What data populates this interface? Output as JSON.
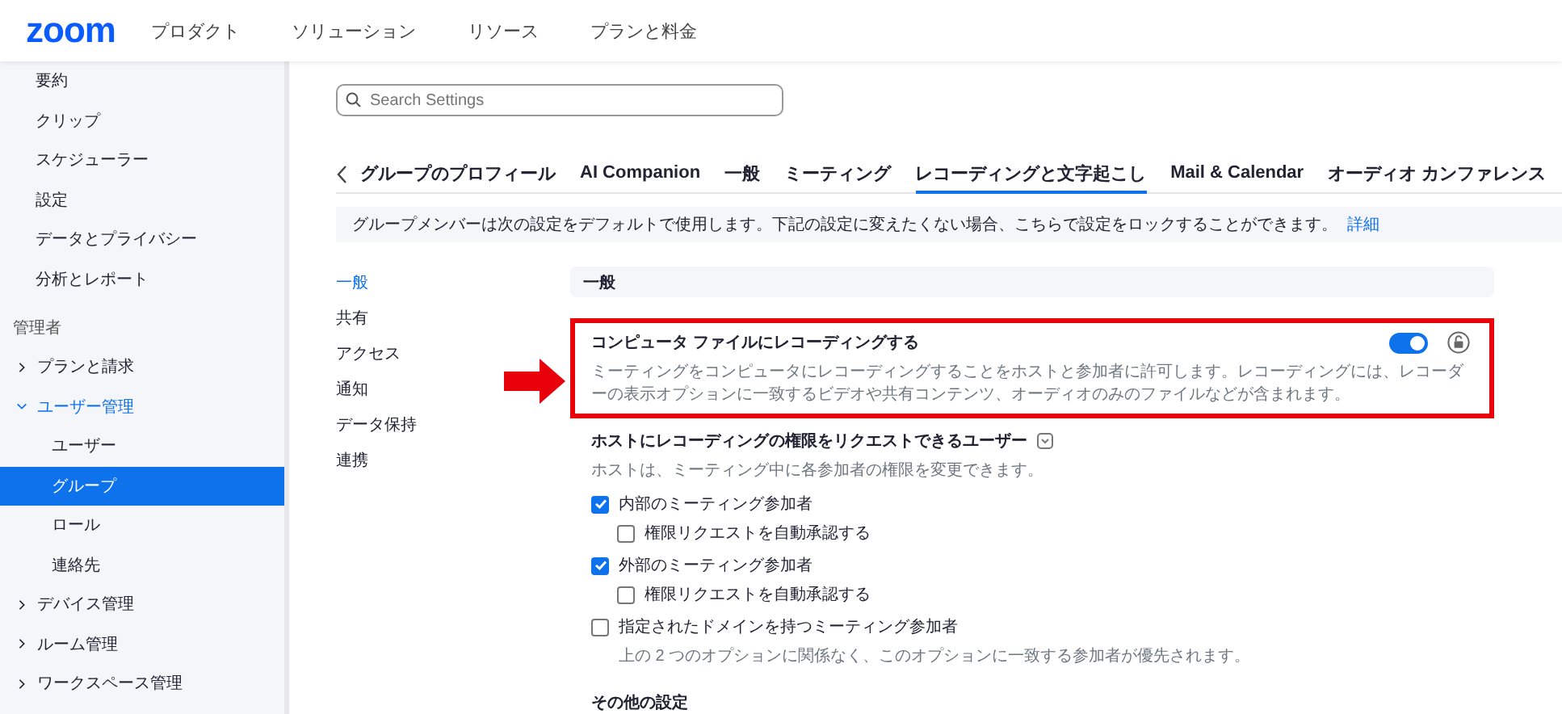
{
  "header": {
    "logo": "zoom",
    "nav": [
      "プロダクト",
      "ソリューション",
      "リソース",
      "プランと料金"
    ]
  },
  "sidebar": {
    "items": [
      {
        "kind": "link",
        "label": "要約",
        "selected": false
      },
      {
        "kind": "link",
        "label": "クリップ",
        "selected": false
      },
      {
        "kind": "link",
        "label": "スケジューラー",
        "selected": false
      },
      {
        "kind": "link",
        "label": "設定",
        "selected": false
      },
      {
        "kind": "link",
        "label": "データとプライバシー",
        "selected": false
      },
      {
        "kind": "link",
        "label": "分析とレポート",
        "selected": false
      },
      {
        "kind": "heading",
        "label": "管理者"
      },
      {
        "kind": "group",
        "label": "プランと請求",
        "expanded": false,
        "selected": false
      },
      {
        "kind": "group",
        "label": "ユーザー管理",
        "expanded": true,
        "selected": false,
        "children": [
          {
            "kind": "link",
            "label": "ユーザー",
            "selected": false
          },
          {
            "kind": "link",
            "label": "グループ",
            "selected": true
          },
          {
            "kind": "link",
            "label": "ロール",
            "selected": false
          },
          {
            "kind": "link",
            "label": "連絡先",
            "selected": false
          }
        ]
      },
      {
        "kind": "group",
        "label": "デバイス管理",
        "expanded": false,
        "selected": false
      },
      {
        "kind": "group",
        "label": "ルーム管理",
        "expanded": false,
        "selected": false
      },
      {
        "kind": "group",
        "label": "ワークスペース管理",
        "expanded": false,
        "selected": false
      }
    ]
  },
  "search": {
    "placeholder": "Search Settings"
  },
  "tabs": [
    {
      "label": "グループのプロフィール",
      "selected": false
    },
    {
      "label": "AI Companion",
      "selected": false
    },
    {
      "label": "一般",
      "selected": false
    },
    {
      "label": "ミーティング",
      "selected": false
    },
    {
      "label": "レコーディングと文字起こし",
      "selected": true
    },
    {
      "label": "Mail & Calendar",
      "selected": false
    },
    {
      "label": "オーディオ カンファレンス",
      "selected": false
    }
  ],
  "banner": {
    "text": "グループメンバーは次の設定をデフォルトで使用します。下記の設定に変えたくない場合、こちらで設定をロックすることができます。",
    "link": "詳細"
  },
  "section_nav": [
    {
      "label": "一般",
      "selected": true
    },
    {
      "label": "共有",
      "selected": false
    },
    {
      "label": "アクセス",
      "selected": false
    },
    {
      "label": "通知",
      "selected": false
    },
    {
      "label": "データ保持",
      "selected": false
    },
    {
      "label": "連携",
      "selected": false
    }
  ],
  "section_title": "一般",
  "settings": [
    {
      "kind": "toggle",
      "title": "コンピュータ ファイルにレコーディングする",
      "description": "ミーティングをコンピュータにレコーディングすることをホストと参加者に許可します。レコーディングには、レコーダーの表示オプションに一致するビデオや共有コンテンツ、オーディオのみのファイルなどが含まれます。",
      "on": true,
      "highlighted": true
    },
    {
      "kind": "options",
      "title": "ホストにレコーディングの権限をリクエストできるユーザー",
      "description": "ホストは、ミーティング中に各参加者の権限を変更できます。",
      "highlighted": false,
      "options": [
        {
          "label": "内部のミーティング参加者",
          "checked": true,
          "children": [
            {
              "label": "権限リクエストを自動承認する",
              "checked": false
            }
          ]
        },
        {
          "label": "外部のミーティング参加者",
          "checked": true,
          "children": [
            {
              "label": "権限リクエストを自動承認する",
              "checked": false
            }
          ]
        },
        {
          "label": "指定されたドメインを持つミーティング参加者",
          "checked": false,
          "note": "上の 2 つのオプションに関係なく、このオプションに一致する参加者が優先されます。"
        }
      ]
    }
  ],
  "next_section": "その他の設定"
}
